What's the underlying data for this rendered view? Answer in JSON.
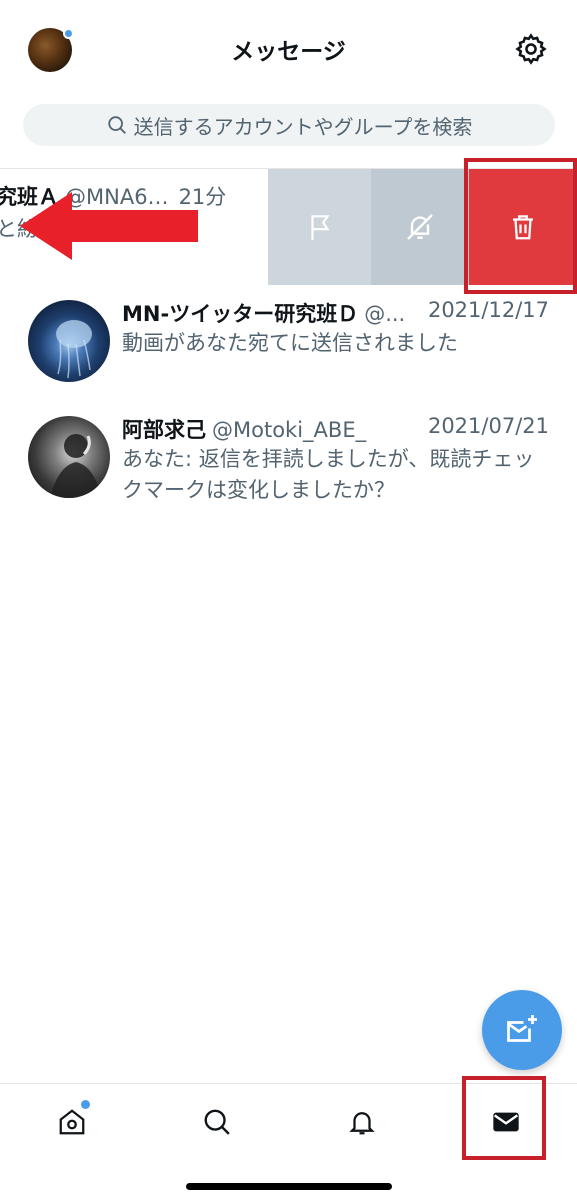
{
  "header": {
    "title": "メッセージ",
    "avatar_icon": "profile-avatar",
    "settings_icon": "gear-icon"
  },
  "search": {
    "placeholder": "送信するアカウントやグループを検索"
  },
  "swiped_conversation": {
    "name": "究班Ａ",
    "handle": "@MNA6…",
    "time": "21分",
    "preview": "と紛",
    "actions": [
      {
        "icon": "flag-icon",
        "color": "#cdd6dc"
      },
      {
        "icon": "mute-bell-icon",
        "color": "#bfc9d1"
      },
      {
        "icon": "trash-icon",
        "color": "#e0393e"
      }
    ]
  },
  "conversations": [
    {
      "name": "MN-ツイッター研究班Ｄ",
      "handle": "@...",
      "date": "2021/12/17",
      "message": "動画があなた宛てに送信されました"
    },
    {
      "name": "阿部求己",
      "handle": "@Motoki_ABE_",
      "date": "2021/07/21",
      "message": "あなた: 返信を拝読しましたが、既読チェックマークは変化しましたか？"
    }
  ],
  "fab": {
    "icon": "new-message-icon",
    "color": "#4a9be8"
  },
  "tabbar": {
    "tabs": [
      {
        "icon": "home-icon",
        "badge": true
      },
      {
        "icon": "search-icon"
      },
      {
        "icon": "bell-icon"
      },
      {
        "icon": "mail-icon",
        "active": true
      }
    ]
  },
  "colors": {
    "accent": "#4a9be8",
    "delete": "#e0393e",
    "annotation": "#c8202a",
    "secondary_text": "#536471"
  }
}
